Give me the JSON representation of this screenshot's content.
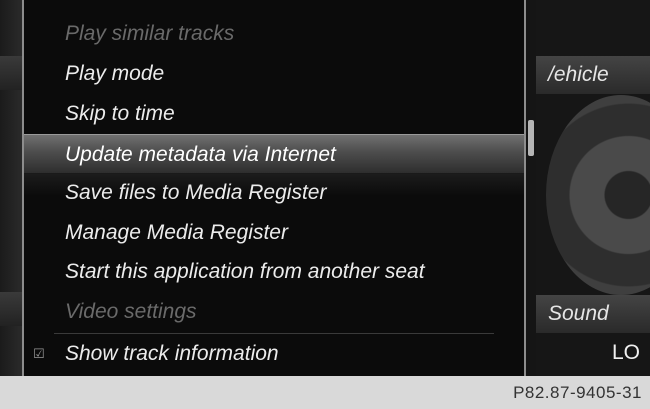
{
  "menu": {
    "items": [
      {
        "label": "Play similar tracks",
        "state": "disabled"
      },
      {
        "label": "Play mode",
        "state": "normal"
      },
      {
        "label": "Skip to time",
        "state": "normal"
      },
      {
        "label": "Update metadata via Internet",
        "state": "selected"
      },
      {
        "label": "Save files to Media Register",
        "state": "normal"
      },
      {
        "label": "Manage Media Register",
        "state": "normal"
      },
      {
        "label": "Start this application from another seat",
        "state": "normal"
      },
      {
        "label": "Video settings",
        "state": "disabled"
      },
      {
        "label": "Show track information",
        "state": "checked"
      }
    ],
    "checkbox_icon": "checkbox-checked-icon"
  },
  "right_panel": {
    "vehicle_label": "/ehicle",
    "sound_label": "Sound",
    "lo_label": "LO"
  },
  "footer": {
    "figure_code": "P82.87-9405-31"
  }
}
